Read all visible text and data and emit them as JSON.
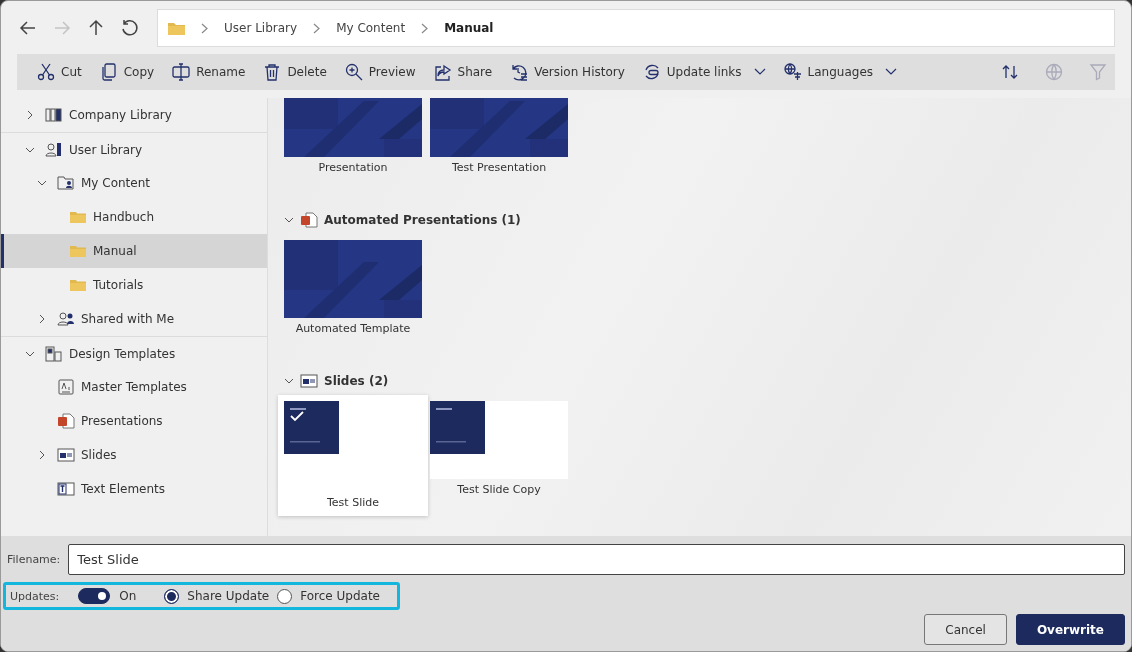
{
  "nav_buttons": [
    {
      "kind": "back",
      "disabled": false
    },
    {
      "kind": "forward",
      "disabled": true
    },
    {
      "kind": "up",
      "disabled": false
    },
    {
      "kind": "refresh",
      "disabled": false
    }
  ],
  "breadcrumb": [
    {
      "label": "User Library",
      "current": false
    },
    {
      "label": "My Content",
      "current": false
    },
    {
      "label": "Manual",
      "current": true
    }
  ],
  "toolbar": [
    {
      "kind": "cut",
      "label": "Cut",
      "dropdown": false
    },
    {
      "kind": "copy",
      "label": "Copy",
      "dropdown": false
    },
    {
      "kind": "rename",
      "label": "Rename",
      "dropdown": false
    },
    {
      "kind": "delete",
      "label": "Delete",
      "dropdown": false
    },
    {
      "kind": "preview",
      "label": "Preview",
      "dropdown": false
    },
    {
      "kind": "share",
      "label": "Share",
      "dropdown": false
    },
    {
      "kind": "history",
      "label": "Version History",
      "dropdown": false
    },
    {
      "kind": "links",
      "label": "Update links",
      "dropdown": true
    },
    {
      "kind": "languages",
      "label": "Languages",
      "dropdown": true
    }
  ],
  "toolbar_right": [
    {
      "kind": "sort",
      "disabled": false
    },
    {
      "kind": "globe",
      "disabled": true
    },
    {
      "kind": "filter",
      "disabled": true
    }
  ],
  "tree": [
    {
      "label": "Company Library",
      "kind": "library",
      "expanded": false,
      "selected": false
    },
    {
      "label": "User Library",
      "kind": "user-library",
      "expanded": true,
      "selected": false,
      "children": [
        {
          "label": "My Content",
          "kind": "user-folder",
          "expanded": true,
          "selected": false,
          "children": [
            {
              "label": "Handbuch",
              "kind": "folder",
              "selected": false
            },
            {
              "label": "Manual",
              "kind": "folder",
              "selected": true
            },
            {
              "label": "Tutorials",
              "kind": "folder",
              "selected": false
            }
          ]
        },
        {
          "label": "Shared with Me",
          "kind": "people",
          "expanded": false,
          "selected": false
        }
      ]
    },
    {
      "label": "Design Templates",
      "kind": "templates",
      "expanded": true,
      "selected": false,
      "children": [
        {
          "label": "Master Templates",
          "kind": "master",
          "selected": false
        },
        {
          "label": "Presentations",
          "kind": "pptx",
          "selected": false
        },
        {
          "label": "Slides",
          "kind": "slide",
          "expanded": false,
          "selected": false
        },
        {
          "label": "Text Elements",
          "kind": "text",
          "selected": false
        }
      ]
    }
  ],
  "groups": [
    {
      "items": [
        {
          "label": "Presentation",
          "kind": "presentation",
          "selected": false
        },
        {
          "label": "Test Presentation",
          "kind": "presentation",
          "selected": false
        }
      ]
    },
    {
      "header": "Automated Presentations (1)",
      "kind": "pptx",
      "expanded": true,
      "items": [
        {
          "label": "Automated Template",
          "kind": "presentation",
          "selected": false
        }
      ]
    },
    {
      "header": "Slides (2)",
      "kind": "slide",
      "expanded": true,
      "items": [
        {
          "label": "Test Slide",
          "kind": "slide",
          "selected": true
        },
        {
          "label": "Test Slide Copy",
          "kind": "slide",
          "selected": false
        }
      ]
    }
  ],
  "filename": {
    "label": "Filename:",
    "value": "Test Slide"
  },
  "updates": {
    "label": "Updates:",
    "on": true,
    "toggle_label": "On",
    "options": [
      {
        "label": "Share Update",
        "selected": true
      },
      {
        "label": "Force Update",
        "selected": false
      }
    ]
  },
  "buttons": [
    {
      "label": "Cancel",
      "kind": "secondary"
    },
    {
      "label": "Overwrite",
      "kind": "primary"
    }
  ]
}
